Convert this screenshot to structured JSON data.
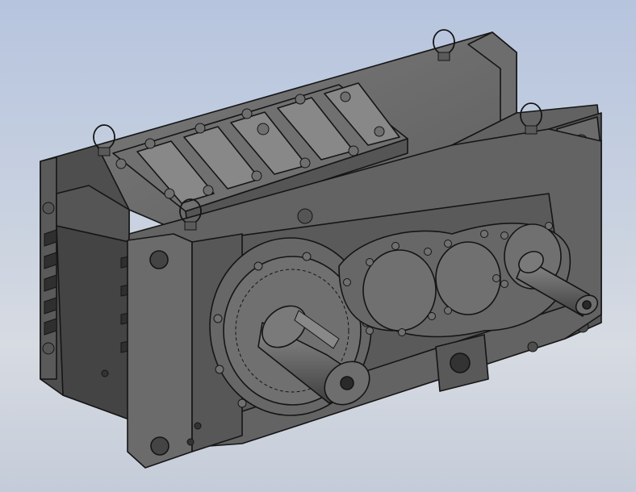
{
  "scene": {
    "background": {
      "top": "#b6c4de",
      "middle": "#d7dbe2",
      "bottom": "#c4ccd9"
    },
    "model": {
      "subject": "industrial-gearbox-housing",
      "shade_colors": {
        "face": "#5d5d5d",
        "front": "#6a6a6a",
        "top": "#777777",
        "dark": "#3c3c3c",
        "edge": "#151515"
      },
      "lifting_eyes": 4,
      "output_shafts": 2,
      "inspection_cover_ribs": 5
    }
  }
}
